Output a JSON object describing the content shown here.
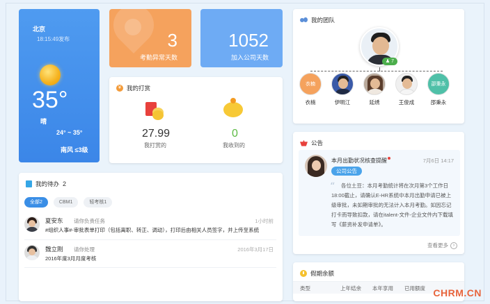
{
  "weather": {
    "city": "北京",
    "published": "18:15:49发布",
    "temperature": "35°",
    "condition": "晴",
    "range": "24° ~ 35°",
    "wind": "南风 ≤3级",
    "icon": "sun-icon"
  },
  "stats": [
    {
      "value": "3",
      "label": "考勤异常天数",
      "color": "#f5a25d"
    },
    {
      "value": "1052",
      "label": "加入公司天数",
      "color": "#6eabf4"
    }
  ],
  "reward": {
    "title": "我的打赏",
    "given": {
      "value": "27.99",
      "label": "我打赏的"
    },
    "received": {
      "value": "0",
      "label": "我收到的"
    }
  },
  "team": {
    "title": "我的团队",
    "leader_badge": "7",
    "members": [
      {
        "name": "衣楠",
        "avatar_text": "衣楠",
        "color": "#f5a25d"
      },
      {
        "name": "伊明江",
        "avatar_text": "",
        "color": "#3a5aa8"
      },
      {
        "name": "延绣",
        "avatar_text": "",
        "color": "#b9a99b"
      },
      {
        "name": "王俊成",
        "avatar_text": "",
        "color": "#f0f0f0"
      },
      {
        "name": "邵秉永",
        "avatar_text": "邵秉永",
        "color": "#4fc0a8"
      }
    ]
  },
  "notice": {
    "title": "公告",
    "item_title": "本月出勤状况核查提醒",
    "date": "7月6日 14:17",
    "tag": "公司公告",
    "body": "各位土豆：本月考勤统计将在次月第3个工作日18:00截止，请确认E-HR系统中本月出勤申请已被上级审批，未如期审批的无法计入本月考勤。如因忘记打卡而导致扣款，请在italent-文件-企业文件内下载填写《薪资补发申请单》。",
    "more": "查看更多"
  },
  "holiday": {
    "title": "假期余额",
    "columns": [
      "类型",
      "上年结余",
      "本年享用",
      "已用额度"
    ]
  },
  "todo": {
    "title": "我的待办",
    "count": "2",
    "filters": [
      "全部2",
      "CBM1",
      "轻考核1"
    ],
    "items": [
      {
        "name": "夏安东",
        "action": "请你负责任务",
        "time": "1小时前",
        "desc": "#组织人事#-审批表单打印（包括离职、转正、调动），打印后由相关人员签字，并上传至系统"
      },
      {
        "name": "魏立刚",
        "action": "请你处理",
        "time": "2016年3月17日",
        "desc": "2016年度3月月度考核"
      }
    ]
  },
  "watermark": "CHRM.CN"
}
